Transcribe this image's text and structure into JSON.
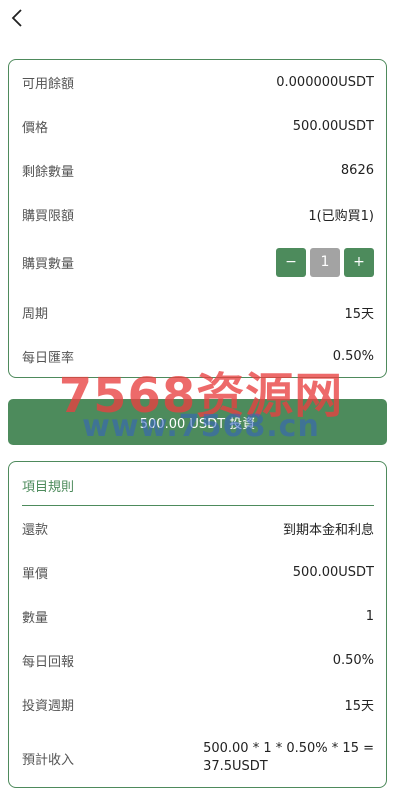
{
  "header": {
    "back_icon": "chevron-left-icon"
  },
  "info": {
    "rows": [
      {
        "label": "可用餘額",
        "value": "0.000000USDT"
      },
      {
        "label": "價格",
        "value": "500.00USDT"
      },
      {
        "label": "剩餘數量",
        "value": "8626"
      },
      {
        "label": "購買限額",
        "value": "1(已购買1)"
      },
      {
        "label": "購買數量"
      },
      {
        "label": "周期",
        "value": "15天"
      },
      {
        "label": "每日匯率",
        "value": "0.50%"
      }
    ],
    "stepper": {
      "minus": "−",
      "value": "1",
      "plus": "+"
    }
  },
  "invest_button": {
    "label": "500.00 USDT 投資"
  },
  "rules": {
    "title": "項目規則",
    "rows": [
      {
        "label": "還款",
        "value": "到期本金和利息"
      },
      {
        "label": "單價",
        "value": "500.00USDT"
      },
      {
        "label": "數量",
        "value": "1"
      },
      {
        "label": "每日回報",
        "value": "0.50%"
      },
      {
        "label": "投資週期",
        "value": "15天"
      },
      {
        "label": "預計收入",
        "value_line1": "500.00 * 1 * 0.50% * 15 =",
        "value_line2": "37.5USDT"
      }
    ]
  },
  "watermark": {
    "line1": "7568资源网",
    "line2": "www.7568.cn"
  },
  "colors": {
    "accent": "#4d8b5c",
    "stepper_value_bg": "#a3a3a3",
    "watermark_red": "#e84040",
    "watermark_blue": "#3460c4"
  }
}
